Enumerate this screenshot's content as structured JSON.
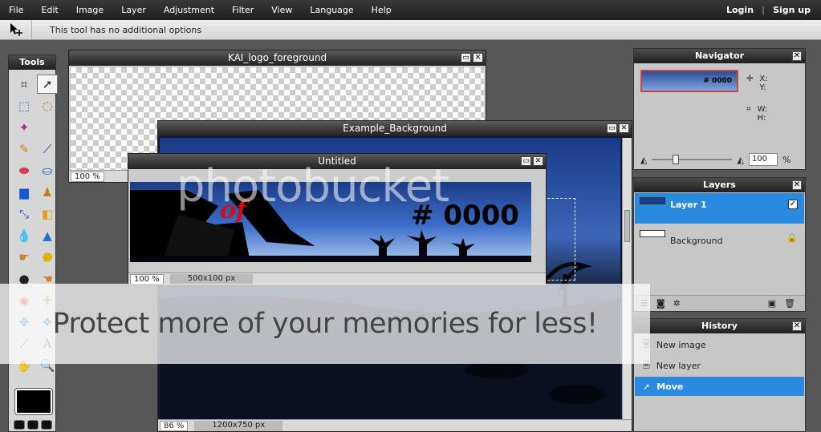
{
  "menu": {
    "items": [
      "File",
      "Edit",
      "Image",
      "Layer",
      "Adjustment",
      "Filter",
      "View",
      "Language",
      "Help"
    ],
    "login": "Login",
    "signup": "Sign up"
  },
  "options_bar": {
    "text": "This tool has no additional options"
  },
  "tools_panel": {
    "title": "Tools"
  },
  "windows": {
    "logo": {
      "title": "KAI_logo_foreground",
      "zoom": "100 %"
    },
    "background": {
      "title": "Example_Background",
      "zoom": "86 %",
      "size": "1200x750 px"
    },
    "untitled": {
      "title": "Untitled",
      "zoom": "100 %",
      "size": "500x100 px",
      "logo_text": "# 0000",
      "of_text": "of"
    }
  },
  "navigator": {
    "title": "Navigator",
    "x_label": "X:",
    "y_label": "Y:",
    "w_label": "W:",
    "h_label": "H:",
    "zoom_value": "100",
    "zoom_unit": "%",
    "thumb_text": "# 0000"
  },
  "layers": {
    "title": "Layers",
    "items": [
      {
        "name": "Layer 1",
        "selected": true,
        "visible": true
      },
      {
        "name": "Background",
        "selected": false,
        "locked": true
      }
    ]
  },
  "history": {
    "title": "History",
    "items": [
      {
        "label": "New image",
        "selected": false
      },
      {
        "label": "New layer",
        "selected": false
      },
      {
        "label": "Move",
        "selected": true
      }
    ]
  },
  "watermark": {
    "text": "Protect more of your memories for less!",
    "logo": "photobucket"
  },
  "colors": {
    "selection": "#2a8ae0",
    "titlebar": "#222222",
    "workspace": "#575757"
  }
}
